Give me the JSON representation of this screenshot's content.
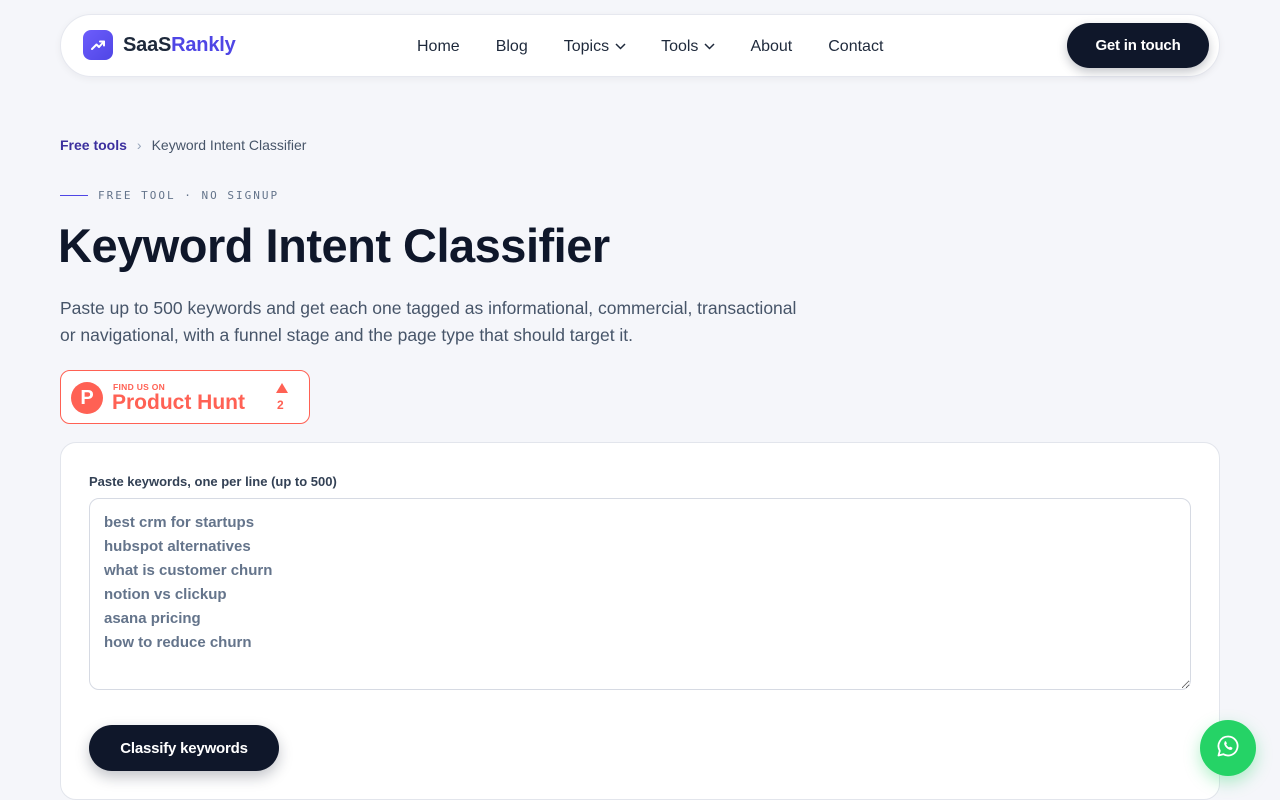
{
  "header": {
    "brand_part1": "SaaS",
    "brand_part2": "Rankly",
    "nav": [
      {
        "label": "Home"
      },
      {
        "label": "Blog"
      },
      {
        "label": "Topics",
        "icon": "chevron-down-icon"
      },
      {
        "label": "Tools",
        "icon": "chevron-down-icon"
      },
      {
        "label": "About"
      },
      {
        "label": "Contact"
      }
    ],
    "cta_label": "Get in touch"
  },
  "breadcrumb": {
    "link": "Free tools",
    "separator": "›",
    "current": "Keyword Intent Classifier"
  },
  "hero": {
    "eyebrow": "FREE TOOL · NO SIGNUP",
    "title": "Keyword Intent Classifier",
    "description": "Paste up to 500 keywords and get each one tagged as informational, commercial, transactional or navigational, with a funnel stage and the page type that should target it."
  },
  "product_hunt": {
    "small_text": "FIND US ON",
    "name": "Product Hunt",
    "logo_letter": "P",
    "upvotes": "2"
  },
  "tool": {
    "label": "Paste keywords, one per line (up to 500)",
    "placeholder": "best crm for startups\nhubspot alternatives\nwhat is customer churn\nnotion vs clickup\nasana pricing\nhow to reduce churn",
    "submit_label": "Classify keywords"
  },
  "colors": {
    "accent": "#4f46e5",
    "dark": "#0f172a",
    "product_hunt": "#ff6154",
    "whatsapp": "#25d366"
  },
  "floating": {
    "icon": "whatsapp-icon"
  }
}
